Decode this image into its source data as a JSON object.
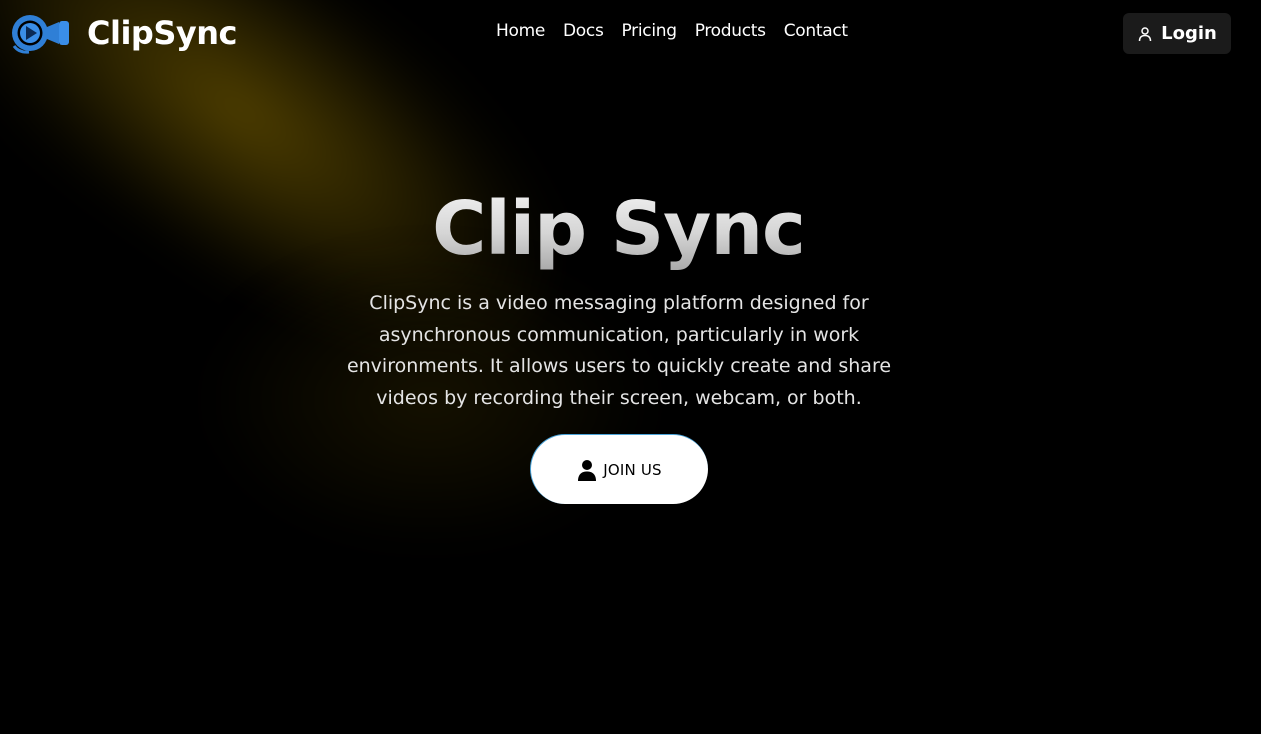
{
  "brand": {
    "name": "ClipSync",
    "logo_icon": "video-camera-play-icon"
  },
  "nav": [
    {
      "label": "Home"
    },
    {
      "label": "Docs"
    },
    {
      "label": "Pricing"
    },
    {
      "label": "Products"
    },
    {
      "label": "Contact"
    }
  ],
  "login": {
    "label": "Login",
    "icon": "user-outline-icon"
  },
  "hero": {
    "title": "Clip Sync",
    "description": "ClipSync is a video messaging platform designed for asynchronous communication, particularly in work environments. It allows users to quickly create and share videos by recording their screen, webcam, or both.",
    "cta_label": "JOIN US",
    "cta_icon": "user-solid-icon"
  },
  "colors": {
    "background": "#000000",
    "glow": "#524100",
    "logo_blue": "#2f7fd6",
    "cta_background": "#ffffff"
  }
}
